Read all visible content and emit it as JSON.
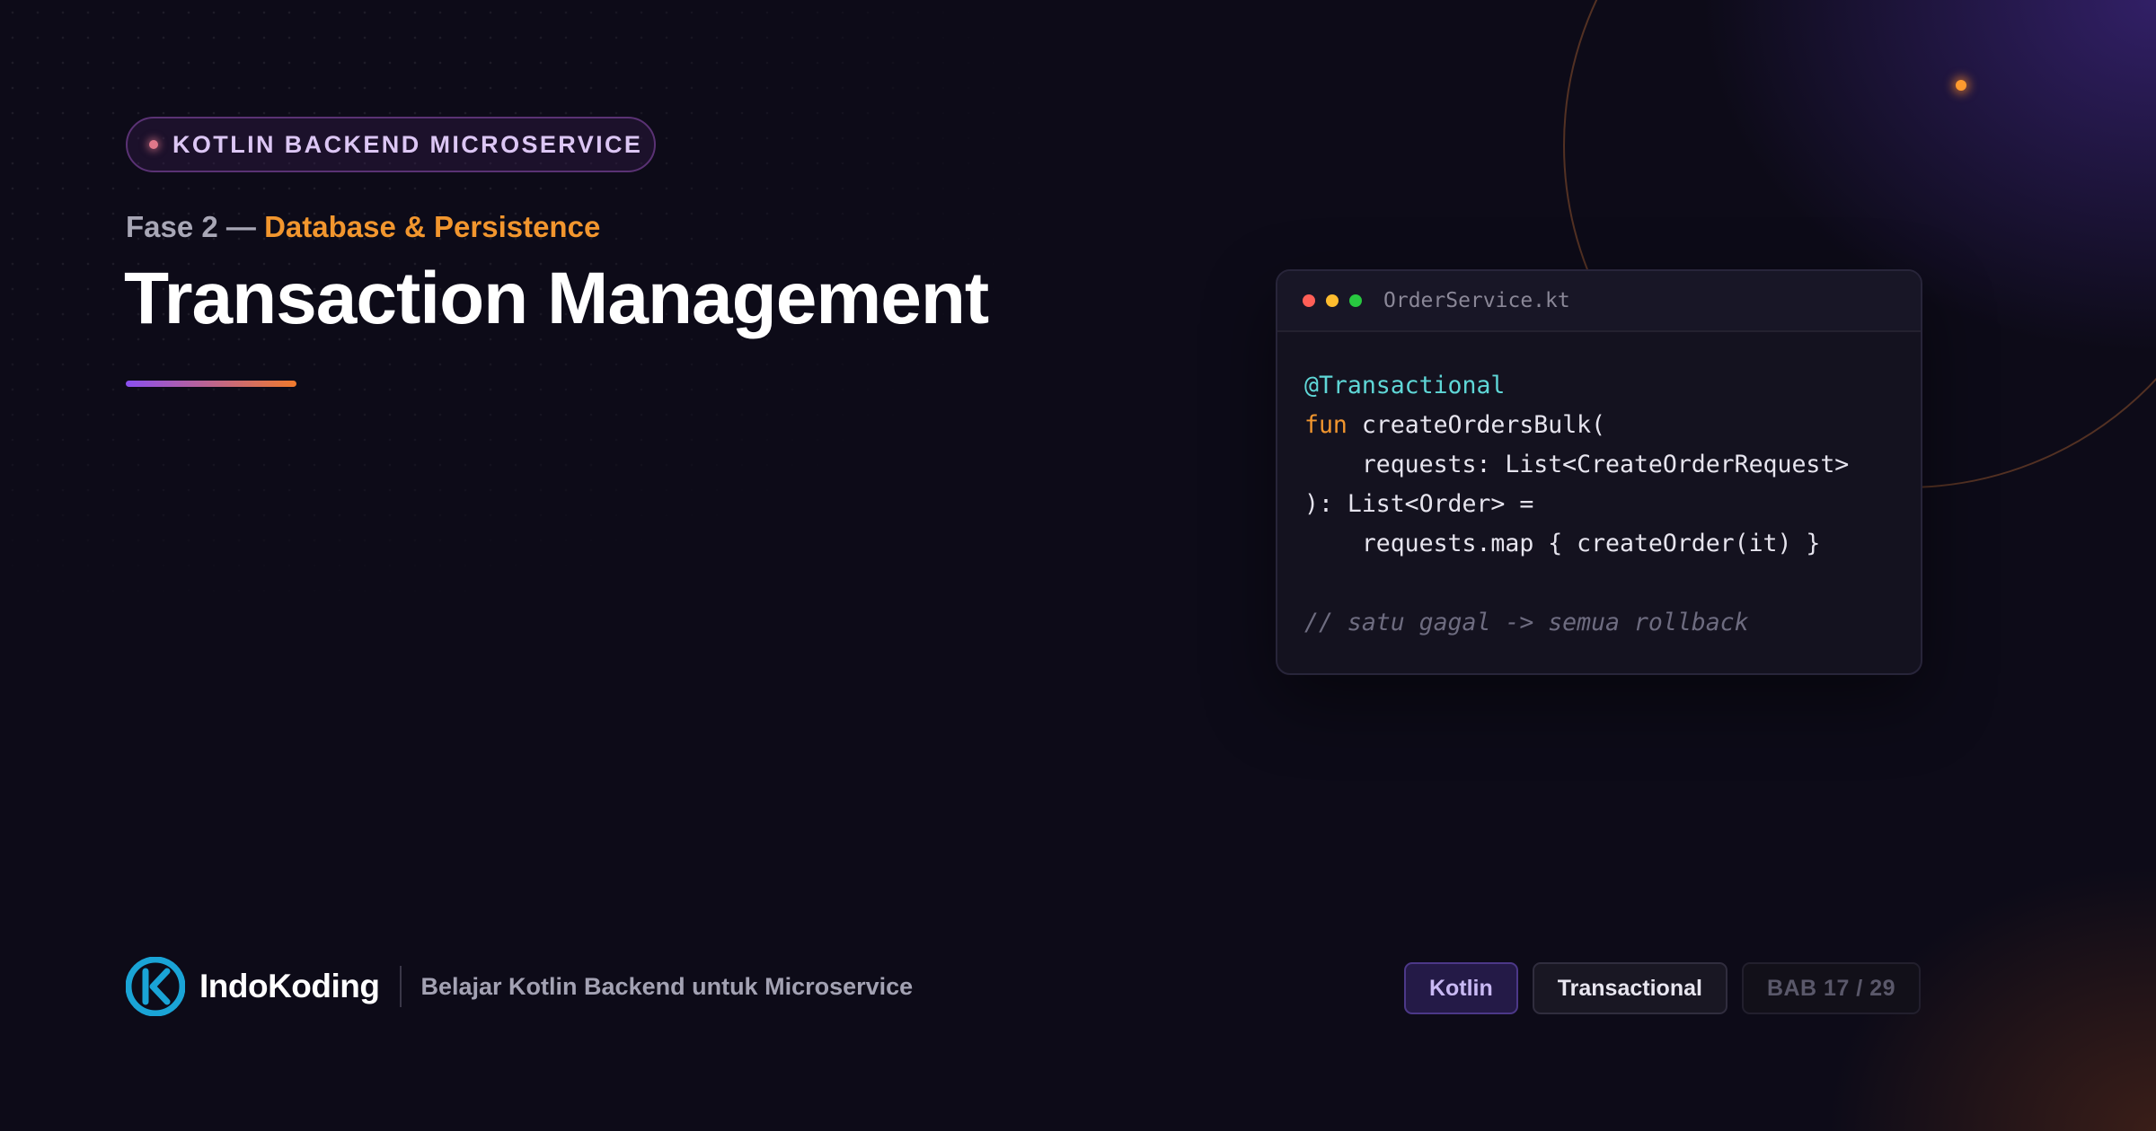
{
  "badge": {
    "label": "KOTLIN BACKEND MICROSERVICE"
  },
  "phase": {
    "number": "Fase 2 —",
    "name": "Database & Persistence"
  },
  "title": "Transaction Management",
  "code_window": {
    "filename": "OrderService.kt",
    "lines": {
      "line1": "@Transactional",
      "line2_keyword": "fun",
      "line2_rest": " createOrdersBulk(",
      "line3": "    requests: List<CreateOrderRequest>",
      "line4": "): List<Order> =",
      "line5": "    requests.map { createOrder(it) }",
      "line7": "// satu gagal -> semua rollback"
    }
  },
  "footer": {
    "brand": "IndoKoding",
    "tagline": "Belajar Kotlin Backend untuk Microservice",
    "tags": [
      "Kotlin",
      "Transactional"
    ],
    "chapter": "BAB 17 / 29"
  },
  "colors": {
    "background": "#0d0b18",
    "accent_orange": "#f2962e",
    "accent_purple": "#8a4ff0",
    "annotation_cyan": "#5fd7d7",
    "logo_blue": "#1aa4d6"
  }
}
